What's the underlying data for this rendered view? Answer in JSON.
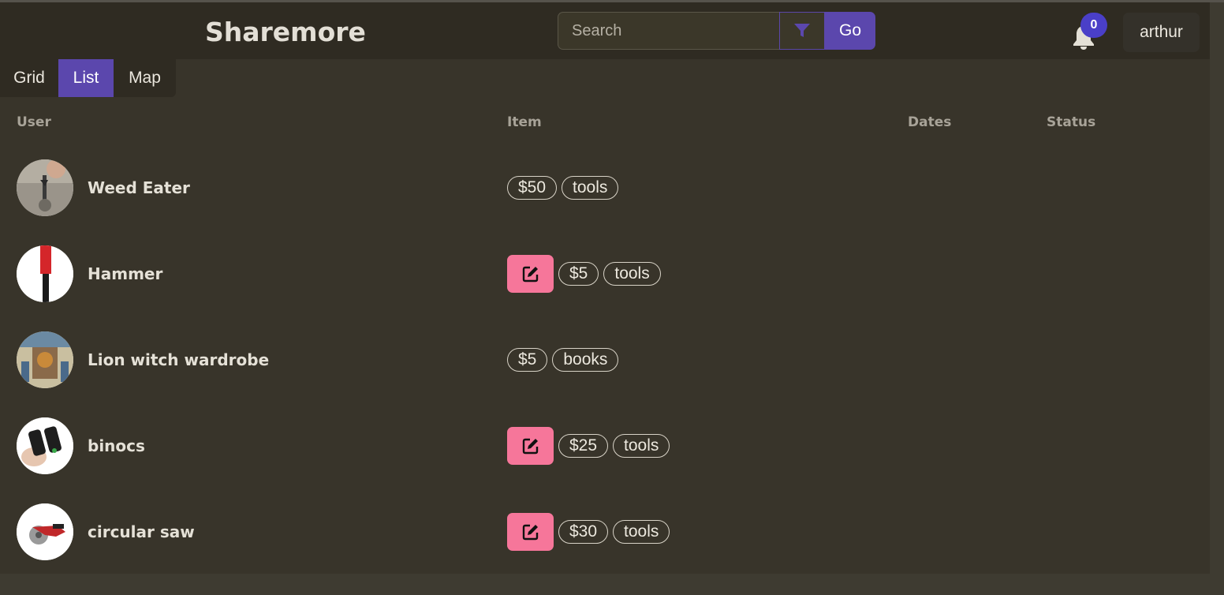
{
  "app": {
    "title": "Sharemore"
  },
  "search": {
    "placeholder": "Search",
    "go_label": "Go"
  },
  "notifications": {
    "count": "0"
  },
  "user": {
    "name": "arthur"
  },
  "view_tabs": [
    {
      "label": "Grid",
      "active": false
    },
    {
      "label": "List",
      "active": true
    },
    {
      "label": "Map",
      "active": false
    }
  ],
  "table": {
    "headers": {
      "user": "User",
      "item": "Item",
      "dates": "Dates",
      "status": "Status"
    },
    "rows": [
      {
        "name": "Weed Eater",
        "editable": false,
        "price": "$50",
        "category": "tools",
        "dates": "",
        "status": ""
      },
      {
        "name": "Hammer",
        "editable": true,
        "price": "$5",
        "category": "tools",
        "dates": "",
        "status": ""
      },
      {
        "name": "Lion witch wardrobe",
        "editable": false,
        "price": "$5",
        "category": "books",
        "dates": "",
        "status": ""
      },
      {
        "name": "binocs",
        "editable": true,
        "price": "$25",
        "category": "tools",
        "dates": "",
        "status": ""
      },
      {
        "name": "circular saw",
        "editable": true,
        "price": "$30",
        "category": "tools",
        "dates": "",
        "status": ""
      }
    ]
  },
  "colors": {
    "accent": "#5b47ad",
    "edit_button": "#f6769a",
    "badge": "#4a3fc8",
    "background": "#38342a",
    "header": "#2f2b22"
  },
  "icons": {
    "filter": "filter-icon",
    "bell": "bell-icon",
    "edit": "edit-icon"
  }
}
